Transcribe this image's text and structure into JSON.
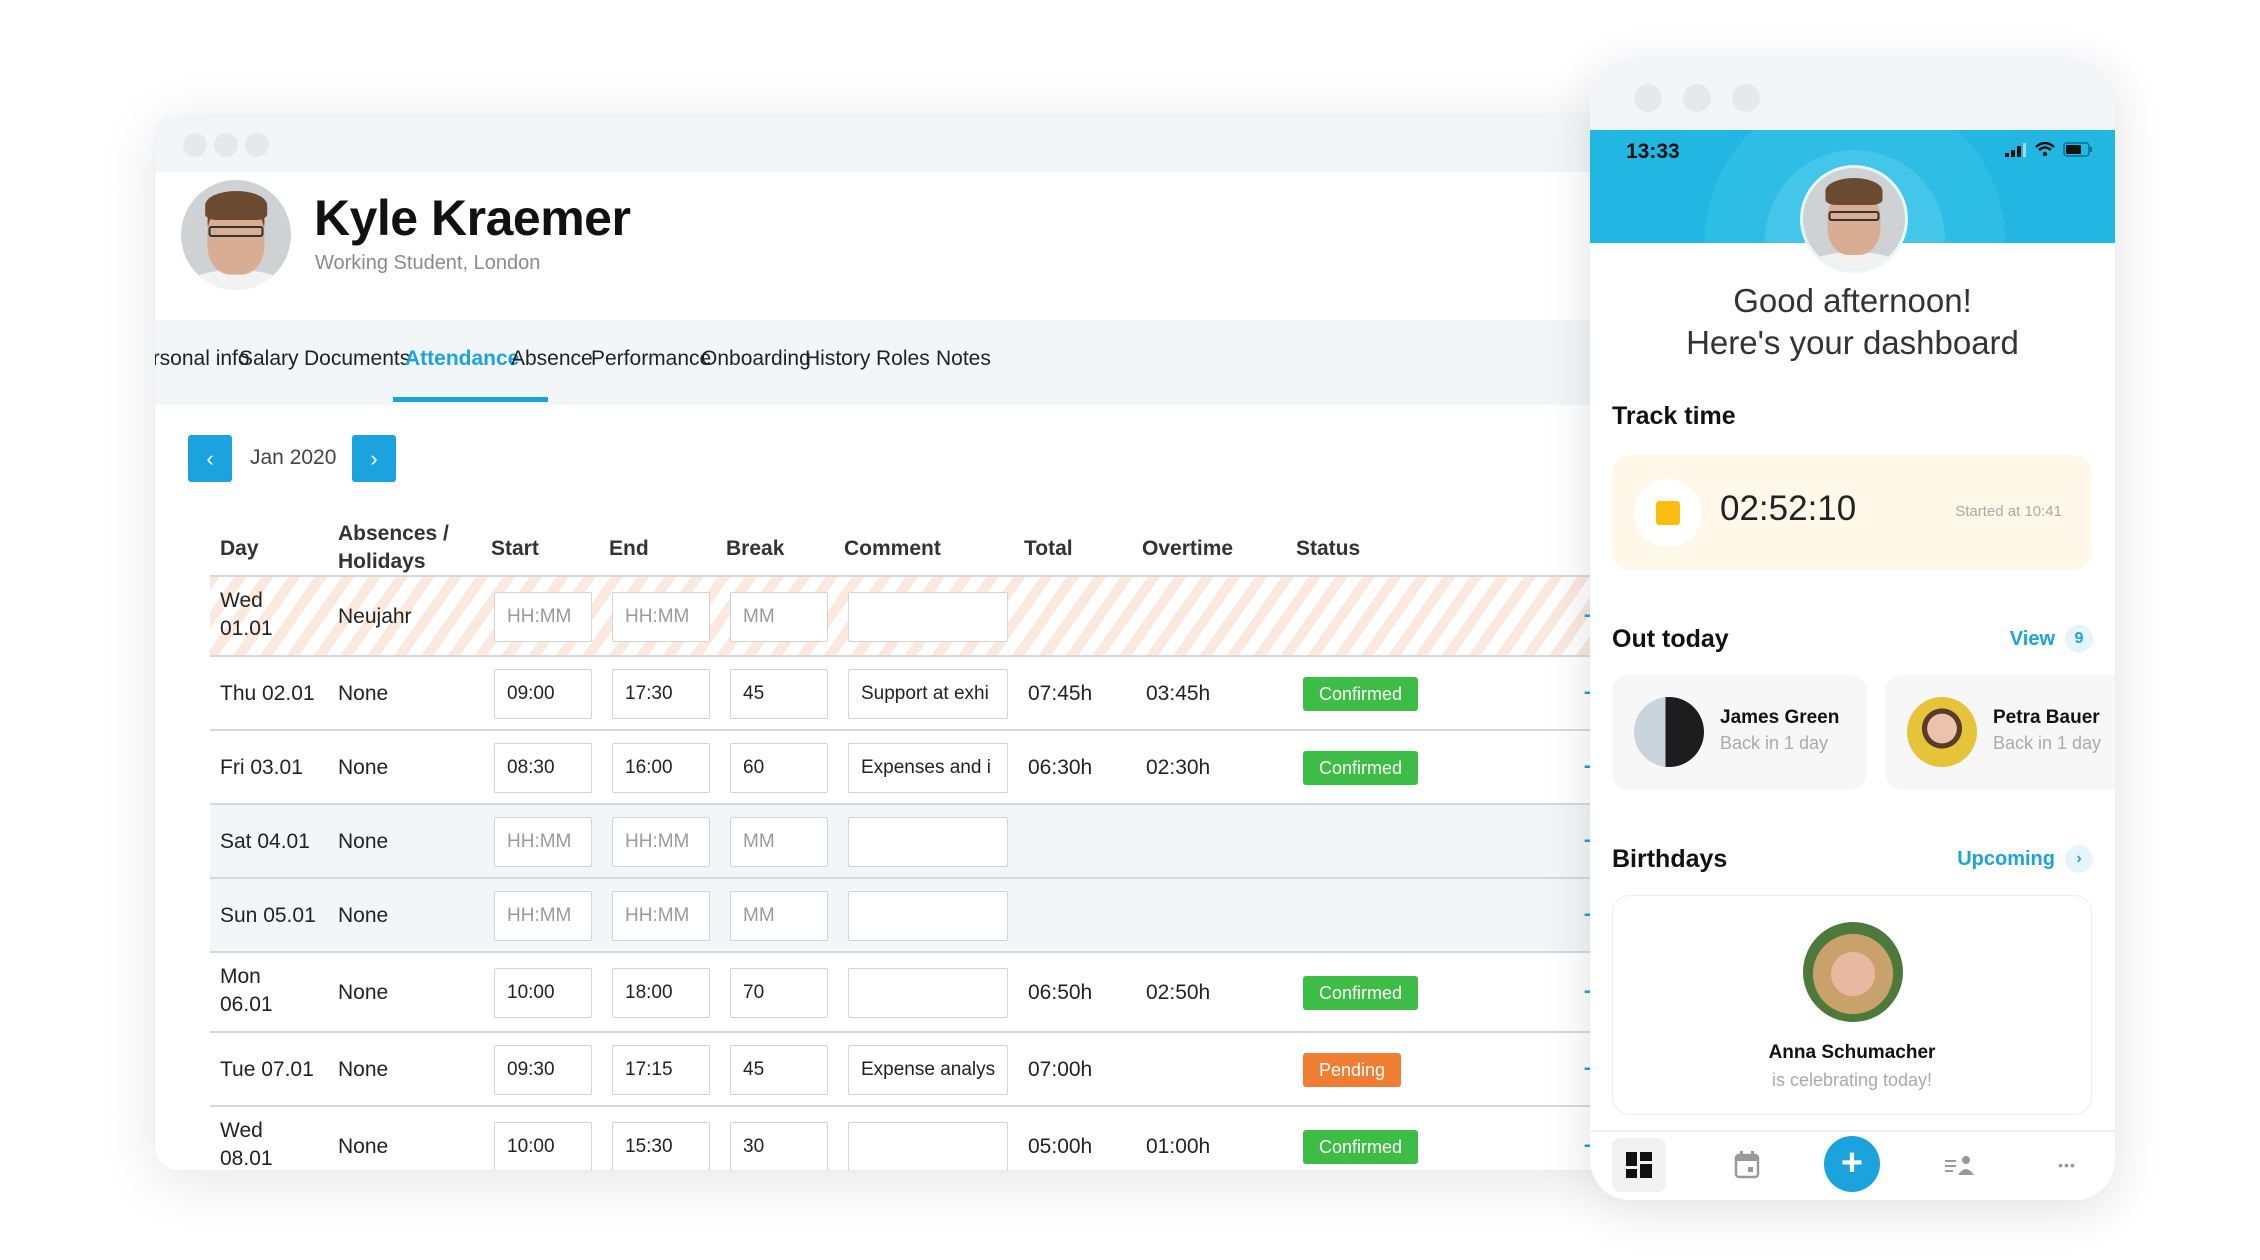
{
  "desktop": {
    "employee": {
      "name": "Kyle Kraemer",
      "role": "Working Student, London"
    },
    "tabs": [
      {
        "label": "Personal info",
        "active": false
      },
      {
        "label": "Salary",
        "active": false
      },
      {
        "label": "Documents",
        "active": false
      },
      {
        "label": "Attendance",
        "active": true
      },
      {
        "label": "Absence",
        "active": false
      },
      {
        "label": "Performance",
        "active": false
      },
      {
        "label": "Onboarding",
        "active": false
      },
      {
        "label": "History",
        "active": false
      },
      {
        "label": "Roles",
        "active": false
      },
      {
        "label": "Notes",
        "active": false
      }
    ],
    "month_nav": {
      "prev_icon": "chevron-left-icon",
      "month": "Jan 2020",
      "next_icon": "chevron-right-icon",
      "prev_glyph": "‹",
      "next_glyph": "›"
    },
    "table": {
      "headers": {
        "day": "Day",
        "absences_1": "Absences /",
        "absences_2": "Holidays",
        "start": "Start",
        "end": "End",
        "break": "Break",
        "comment": "Comment",
        "total": "Total",
        "overtime": "Overtime",
        "status": "Status"
      },
      "placeholders": {
        "time": "HH:MM",
        "minutes": "MM"
      },
      "rows": [
        {
          "day1": "Wed",
          "day2": "01.01",
          "absence": "Neujahr",
          "start": "",
          "end": "",
          "break": "",
          "comment": "",
          "total": "",
          "overtime": "",
          "status": "",
          "type": "holiday"
        },
        {
          "day1": "Thu 02.01",
          "day2": "",
          "absence": "None",
          "start": "09:00",
          "end": "17:30",
          "break": "45",
          "comment": "Support at exhi",
          "total": "07:45h",
          "overtime": "03:45h",
          "status": "Confirmed",
          "type": "normal"
        },
        {
          "day1": "Fri 03.01",
          "day2": "",
          "absence": "None",
          "start": "08:30",
          "end": "16:00",
          "break": "60",
          "comment": "Expenses and i",
          "total": "06:30h",
          "overtime": "02:30h",
          "status": "Confirmed",
          "type": "normal"
        },
        {
          "day1": "Sat 04.01",
          "day2": "",
          "absence": "None",
          "start": "",
          "end": "",
          "break": "",
          "comment": "",
          "total": "",
          "overtime": "",
          "status": "",
          "type": "weekend"
        },
        {
          "day1": "Sun 05.01",
          "day2": "",
          "absence": "None",
          "start": "",
          "end": "",
          "break": "",
          "comment": "",
          "total": "",
          "overtime": "",
          "status": "",
          "type": "weekend"
        },
        {
          "day1": "Mon",
          "day2": "06.01",
          "absence": "None",
          "start": "10:00",
          "end": "18:00",
          "break": "70",
          "comment": "",
          "total": "06:50h",
          "overtime": "02:50h",
          "status": "Confirmed",
          "type": "normal"
        },
        {
          "day1": "Tue 07.01",
          "day2": "",
          "absence": "None",
          "start": "09:30",
          "end": "17:15",
          "break": "45",
          "comment": "Expense analys",
          "total": "07:00h",
          "overtime": "",
          "status": "Pending",
          "type": "normal"
        },
        {
          "day1": "Wed",
          "day2": "08.01",
          "absence": "None",
          "start": "10:00",
          "end": "15:30",
          "break": "30",
          "comment": "",
          "total": "05:00h",
          "overtime": "01:00h",
          "status": "Confirmed",
          "type": "normal"
        }
      ],
      "row_actions": {
        "add_glyph": "+",
        "add_icon": "plus-icon",
        "delete_icon": "trash-icon"
      }
    },
    "colors": {
      "accent": "#1aa3dc",
      "confirmed": "#3dbd45",
      "pending": "#ef7d32",
      "delete": "#e0554e"
    }
  },
  "mobile": {
    "status_bar": {
      "time": "13:33",
      "icons": [
        "signal-icon",
        "wifi-icon",
        "battery-icon"
      ]
    },
    "greeting_1": "Good afternoon!",
    "greeting_2": "Here's your dashboard",
    "track_time": {
      "title": "Track time",
      "timer": "02:52:10",
      "started": "Started at 10:41",
      "stop_icon": "stop-icon"
    },
    "out_today": {
      "title": "Out today",
      "link": "View",
      "count": "9",
      "people": [
        {
          "name": "James Green",
          "status": "Back in 1 day"
        },
        {
          "name": "Petra Bauer",
          "status": "Back in 1 day"
        }
      ]
    },
    "birthdays": {
      "title": "Birthdays",
      "link": "Upcoming",
      "link_glyph": "›",
      "person": {
        "name": "Anna Schumacher",
        "status": "is celebrating today!"
      }
    },
    "bottom_nav": {
      "items": [
        "dashboard-icon",
        "calendar-icon",
        "add-icon",
        "people-list-icon",
        "more-icon"
      ],
      "fab_glyph": "+",
      "more_glyph": "•••"
    },
    "colors": {
      "header": "#21b7e2",
      "timer_bg": "#fff7e8",
      "stop": "#fcbd11"
    }
  }
}
